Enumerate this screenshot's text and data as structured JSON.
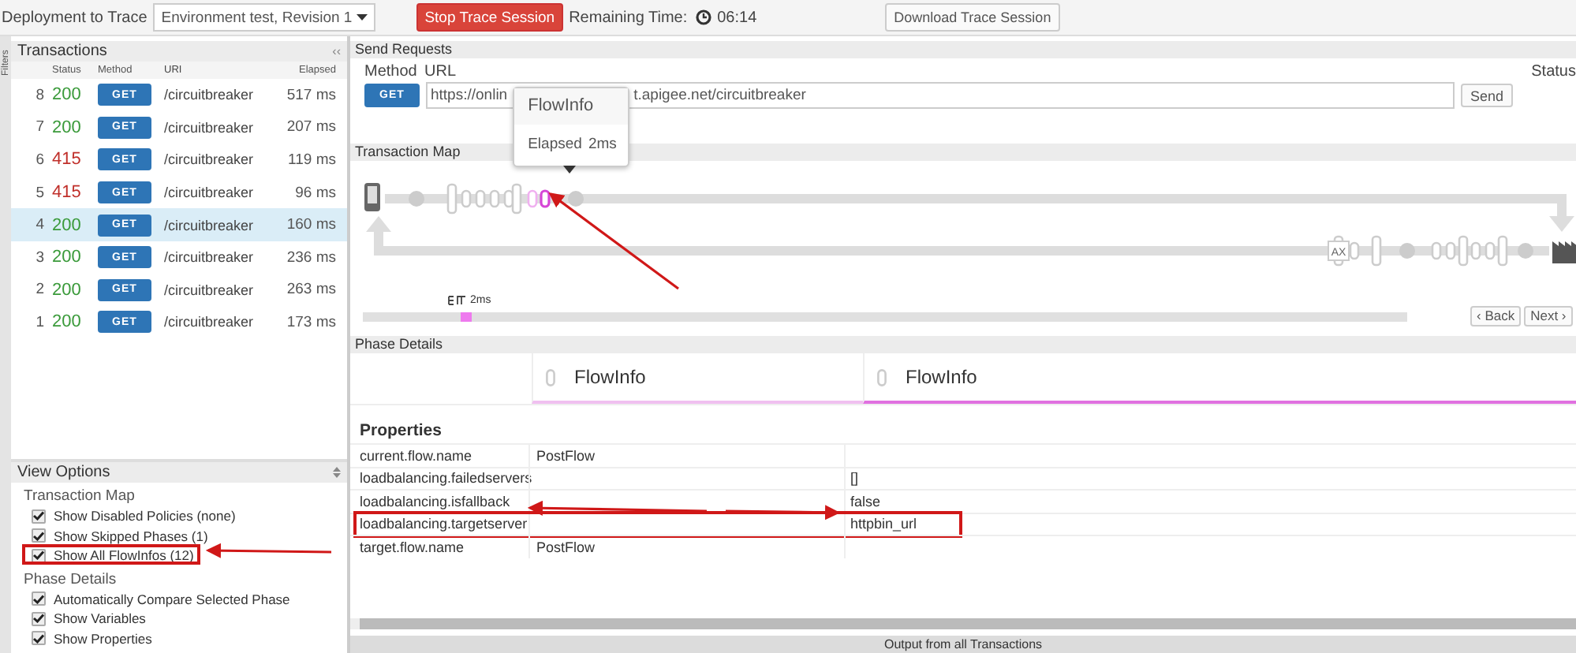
{
  "top_bar": {
    "deployment_label": "Deployment to Trace",
    "deployment_select": "Environment test, Revision 1",
    "stop_button": "Stop Trace Session",
    "remaining_label": "Remaining Time:",
    "remaining_time": "06:14",
    "download_button": "Download Trace Session"
  },
  "filters_tab": "Filters",
  "transactions": {
    "title": "Transactions",
    "collapse": "‹‹",
    "columns": [
      "Status",
      "Method",
      "URI",
      "Elapsed"
    ],
    "rows": [
      {
        "number": "8",
        "status": "200",
        "color": "#3a9a3a",
        "method": "GET",
        "uri": "/circuitbreaker",
        "elapsed": "517 ms",
        "selected": false
      },
      {
        "number": "7",
        "status": "200",
        "color": "#3a9a3a",
        "method": "GET",
        "uri": "/circuitbreaker",
        "elapsed": "207 ms",
        "selected": false
      },
      {
        "number": "6",
        "status": "415",
        "color": "#c0302b",
        "method": "GET",
        "uri": "/circuitbreaker",
        "elapsed": "119 ms",
        "selected": false
      },
      {
        "number": "5",
        "status": "415",
        "color": "#c0302b",
        "method": "GET",
        "uri": "/circuitbreaker",
        "elapsed": "96 ms",
        "selected": false
      },
      {
        "number": "4",
        "status": "200",
        "color": "#3a9a3a",
        "method": "GET",
        "uri": "/circuitbreaker",
        "elapsed": "160 ms",
        "selected": true
      },
      {
        "number": "3",
        "status": "200",
        "color": "#3a9a3a",
        "method": "GET",
        "uri": "/circuitbreaker",
        "elapsed": "236 ms",
        "selected": false
      },
      {
        "number": "2",
        "status": "200",
        "color": "#3a9a3a",
        "method": "GET",
        "uri": "/circuitbreaker",
        "elapsed": "263 ms",
        "selected": false
      },
      {
        "number": "1",
        "status": "200",
        "color": "#3a9a3a",
        "method": "GET",
        "uri": "/circuitbreaker",
        "elapsed": "173 ms",
        "selected": false
      }
    ]
  },
  "view_options": {
    "title": "View Options",
    "groups": [
      {
        "title": "Transaction Map",
        "options": [
          {
            "label": "Show Disabled Policies (none)",
            "checked": true,
            "annotated": false
          },
          {
            "label": "Show Skipped Phases (1)",
            "checked": true,
            "annotated": false
          },
          {
            "label": "Show All FlowInfos (12)",
            "checked": true,
            "annotated": true
          }
        ]
      },
      {
        "title": "Phase Details",
        "options": [
          {
            "label": "Automatically Compare Selected Phase",
            "checked": true,
            "annotated": false
          },
          {
            "label": "Show Variables",
            "checked": true,
            "annotated": false
          },
          {
            "label": "Show Properties",
            "checked": true,
            "annotated": false
          }
        ]
      }
    ]
  },
  "send_requests": {
    "title": "Send Requests",
    "method_label": "Method",
    "url_label": "URL",
    "status_label": "Status",
    "method_button": "GET",
    "url_start": "https://onlin",
    "url_end": "t.apigee.net/circuitbreaker",
    "send_button": "Send"
  },
  "transaction_map": {
    "title": "Transaction Map",
    "ax_label": "AX",
    "tooltip": {
      "title": "FlowInfo",
      "label": "Elapsed",
      "value": "2ms"
    },
    "timeline_label": "2ms",
    "back_button": "‹ Back",
    "next_button": "Next ›"
  },
  "phase_details": {
    "title": "Phase Details",
    "columns": [
      {
        "label": "FlowInfo",
        "selected": false
      },
      {
        "label": "FlowInfo",
        "selected": true
      }
    ]
  },
  "properties": {
    "title": "Properties",
    "rows": [
      {
        "name": "current.flow.name",
        "value_1": "PostFlow",
        "value_2": "",
        "annotated": false
      },
      {
        "name": "loadbalancing.failedservers",
        "value_1": "",
        "value_2": "[]",
        "annotated": false
      },
      {
        "name": "loadbalancing.isfallback",
        "value_1": "",
        "value_2": "false",
        "annotated": false
      },
      {
        "name": "loadbalancing.targetserver",
        "value_1": "",
        "value_2": "httpbin_url",
        "annotated": true
      },
      {
        "name": "target.flow.name",
        "value_1": "PostFlow",
        "value_2": "",
        "annotated": false
      }
    ]
  },
  "output_bar": "Output from all Transactions"
}
